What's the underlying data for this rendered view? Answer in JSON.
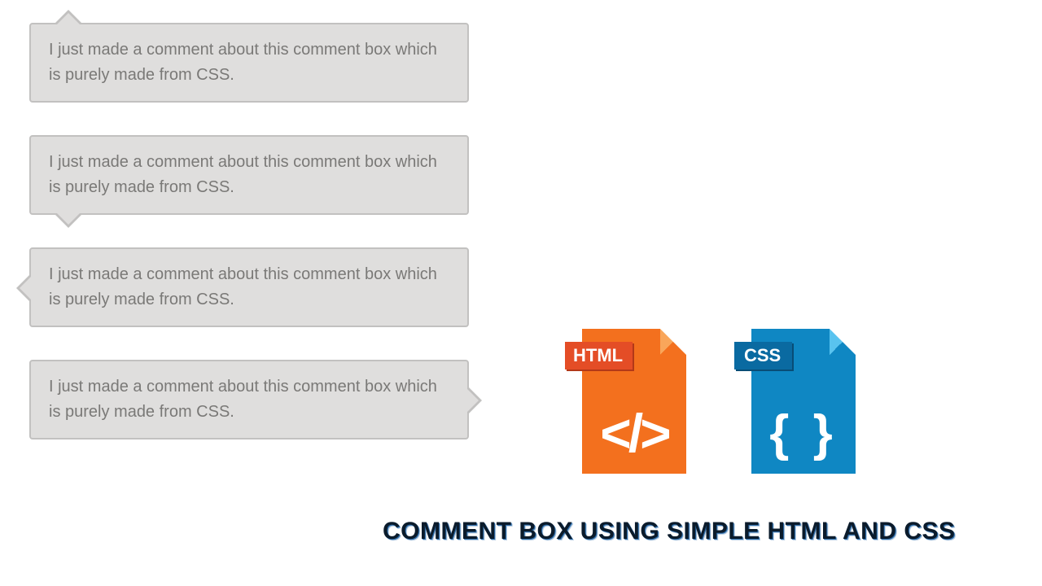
{
  "comments": [
    {
      "text": "I just made a comment about this comment box which is purely made from CSS.",
      "pointer": "top-left"
    },
    {
      "text": "I just made a comment about this comment box which is purely made from CSS.",
      "pointer": "bottom-left"
    },
    {
      "text": "I just made a comment about this comment box which is purely made from CSS.",
      "pointer": "left"
    },
    {
      "text": "I just made a comment about this comment box which is purely made from CSS.",
      "pointer": "right"
    }
  ],
  "icons": {
    "html": {
      "label": "HTML",
      "glyph": "</>"
    },
    "css": {
      "label": "CSS",
      "glyph": "{ }"
    }
  },
  "headline": "COMMENT BOX USING SIMPLE HTML AND CSS"
}
